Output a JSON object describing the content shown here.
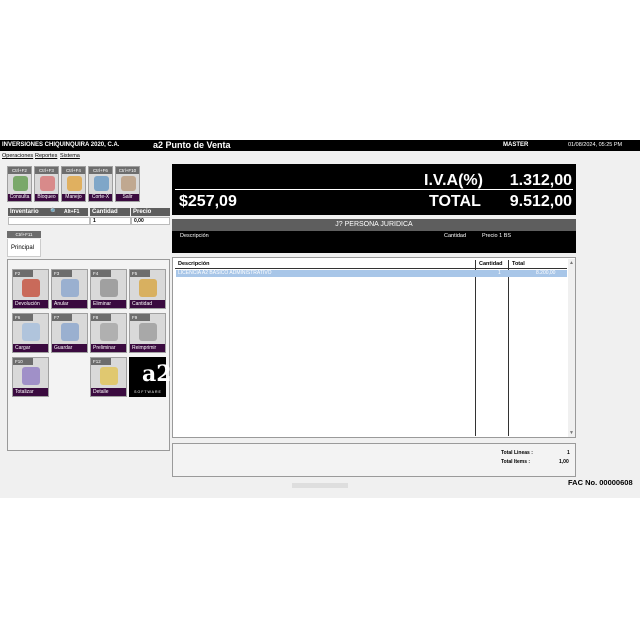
{
  "titlebar": {
    "company": "INVERSIONES CHIQUINQUIRA 2020, C.A.",
    "app": "a2 Punto de Venta",
    "user": "MASTER",
    "datetime": "01/08/2024, 05:25 PM"
  },
  "menu": [
    "Operaciones",
    "Reportes",
    "Sistema"
  ],
  "toolbar": [
    {
      "key": "Ctrl+F2",
      "label": "Consulta",
      "icon": "search-doc-icon",
      "color": "#7aa86a"
    },
    {
      "key": "Ctrl+F3",
      "label": "Bloqueo",
      "icon": "lock-icon",
      "color": "#d88a8a"
    },
    {
      "key": "Ctrl+F4",
      "label": "Manejo",
      "icon": "cash-icon",
      "color": "#e0b060"
    },
    {
      "key": "Ctrl+F6",
      "label": "Corte-X",
      "icon": "scissors-icon",
      "color": "#7fa6c8"
    },
    {
      "key": "Ctrl+F10",
      "label": "Salir",
      "icon": "exit-icon",
      "color": "#c0a890"
    }
  ],
  "inventory": {
    "col_inventario": "Inventario",
    "shortcut": "Alt+F1",
    "col_cantidad": "Cantidad",
    "col_precio": "Precio",
    "cantidad_value": "1",
    "precio_value": "0,00"
  },
  "tab": {
    "key": "Ctrl+F11",
    "label": "Principal"
  },
  "actions": [
    {
      "key": "F2",
      "label": "Devolución",
      "icon": "return-icon",
      "color": "#c96a5a"
    },
    {
      "key": "F3",
      "label": "Anular",
      "icon": "cancel-doc-icon",
      "color": "#9ab0d0"
    },
    {
      "key": "F4",
      "label": "Eliminar",
      "icon": "trash-icon",
      "color": "#a0a0a0"
    },
    {
      "key": "F5",
      "label": "Cantidad",
      "icon": "coins-icon",
      "color": "#d8b060"
    },
    {
      "key": "F6",
      "label": "Cargar",
      "icon": "load-icon",
      "color": "#b0c4dc"
    },
    {
      "key": "F7",
      "label": "Guardar",
      "icon": "save-icon",
      "color": "#9ab0d0"
    },
    {
      "key": "F8",
      "label": "Preliminar",
      "icon": "glasses-icon",
      "color": "#b0b0b0"
    },
    {
      "key": "F9",
      "label": "Reimprimir",
      "icon": "printer-icon",
      "color": "#a8a8a8"
    },
    {
      "key": "F10",
      "label": "Totalizar",
      "icon": "total-icon",
      "color": "#a090c8"
    },
    {
      "key": "F12",
      "label": "Detalle",
      "icon": "detail-icon",
      "color": "#e0c870"
    }
  ],
  "logo": {
    "text": "a2",
    "sub": "SOFTWARE"
  },
  "totals": {
    "iva_label": "I.V.A(%)",
    "iva_value": "1.312,00",
    "bs_value": "$257,09",
    "total_label": "TOTAL",
    "total_value": "9.512,00"
  },
  "customer": {
    "name": "J? PERSONA JURIDICA",
    "col_descripcion": "Descripción",
    "col_cantidad": "Cantidad",
    "col_precio": "Precio 1 BS"
  },
  "grid": {
    "headers": [
      "Descripción",
      "Cantidad",
      "Total"
    ],
    "rows": [
      {
        "descripcion": "LICENCIA A2 BASICO ADMINISTRATIVO",
        "cantidad": "1",
        "total": "8.200,00"
      }
    ]
  },
  "summary": {
    "lineas_label": "Total Lineas :",
    "lineas_value": "1",
    "items_label": "Total Items :",
    "items_value": "1,00"
  },
  "invoice": "FAC No. 00000608"
}
